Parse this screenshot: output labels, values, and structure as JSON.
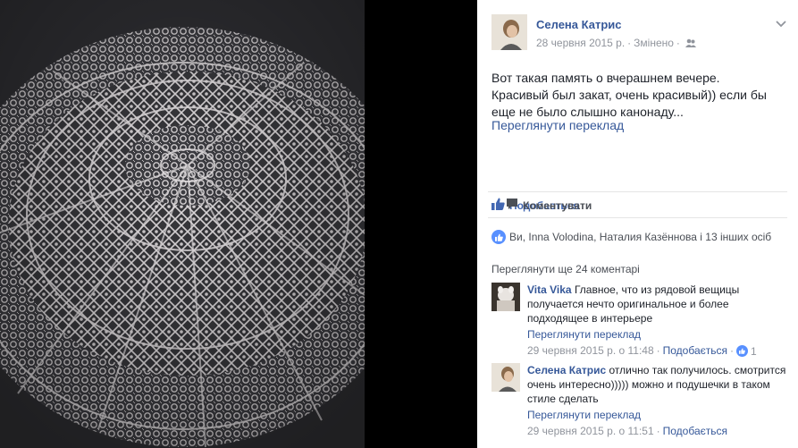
{
  "post": {
    "author": "Селена Катрис",
    "date": "28 червня 2015 р.",
    "edited": "Змінено",
    "text_lines": [
      "Вот такая память о вчерашнем вечере.",
      "Красивый был закат, очень красивый)) если бы",
      "еще не было слышно канонаду..."
    ],
    "see_translation": "Переглянути переклад"
  },
  "actions": {
    "like": "Подобається",
    "comment": "Коментувати"
  },
  "likes_summary": "Ви, Inna Volodina, Наталия Казённова і 13 інших осіб",
  "view_more_comments": "Переглянути ще 24 коментарі",
  "comments": [
    {
      "author": "Vita Vika",
      "text": "Главное, что из рядовой вещицы получается нечто оригинальное и более подходящее в интерьере",
      "see_translation": "Переглянути переклад",
      "date": "29 червня 2015 р. о 11:48",
      "like_label": "Подобається",
      "like_count": "1"
    },
    {
      "author": "Селена Катрис",
      "text": "отлично так получилось. смотрится очень интересно))))) можно и подушечки в таком стиле сделать",
      "see_translation": "Переглянути переклад",
      "date": "29 червня 2015 р. о 11:51",
      "like_label": "Подобається",
      "like_count": ""
    }
  ],
  "colors": {
    "link": "#365899",
    "like_blue": "#4267b2",
    "meta_gray": "#90949c"
  },
  "icons": {
    "audience": "people-icon",
    "menu": "chevron-down-icon",
    "like": "thumbs-up-icon",
    "comment": "speech-bubble-icon"
  }
}
